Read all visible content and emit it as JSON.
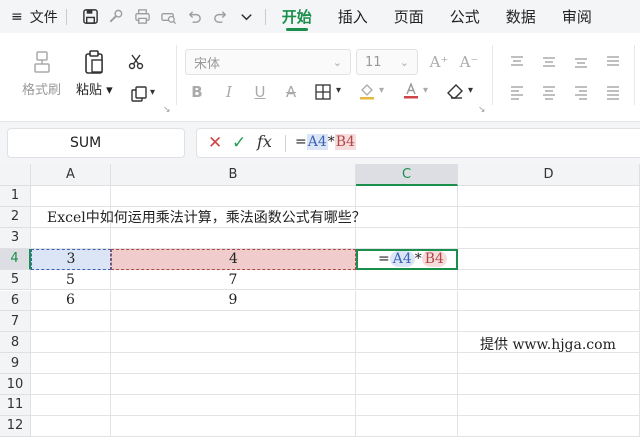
{
  "menubar": {
    "menu_icon": "≡",
    "file_label": "文件",
    "tabs": [
      {
        "label": "开始",
        "active": true
      },
      {
        "label": "插入",
        "active": false
      },
      {
        "label": "页面",
        "active": false
      },
      {
        "label": "公式",
        "active": false
      },
      {
        "label": "数据",
        "active": false
      },
      {
        "label": "审阅",
        "active": false
      }
    ],
    "quick_access_icons": [
      "save-icon",
      "format-painter-icon",
      "print-icon",
      "print-preview-icon",
      "undo-icon",
      "redo-icon",
      "more-chevron-icon"
    ]
  },
  "ribbon": {
    "format_painter_label": "格式刷",
    "paste_label": "粘贴",
    "font_name": "宋体",
    "font_size": "11",
    "grow_font": "A⁺",
    "shrink_font": "A⁻"
  },
  "formula_bar": {
    "name_box": "SUM",
    "cancel_icon": "✕",
    "confirm_icon": "✓",
    "fx_label": "fx",
    "formula_prefix": "=",
    "ref_a": "A4",
    "operator": "*",
    "ref_b": "B4"
  },
  "sheet": {
    "columns": [
      "A",
      "B",
      "C",
      "D"
    ],
    "selected_column": "C",
    "selected_row": "4",
    "rows": [
      "1",
      "2",
      "3",
      "4",
      "5",
      "6",
      "7",
      "8",
      "9",
      "10",
      "11",
      "12"
    ],
    "cells": {
      "A2": "Excel中如何运用乘法计算，乘法函数公式有哪些？",
      "A4": "3",
      "B4": "4",
      "A5": "5",
      "B5": "7",
      "A6": "6",
      "B6": "9"
    },
    "c4_formula": {
      "prefix": "=",
      "ref_a": "A4",
      "operator": "*",
      "ref_b": "B4"
    },
    "watermark": "提供 www.hjga.com"
  },
  "colors": {
    "accent": "#1a8f4c",
    "ref_a_fill": "#dbe5f6",
    "ref_b_fill": "#f0cccc"
  }
}
